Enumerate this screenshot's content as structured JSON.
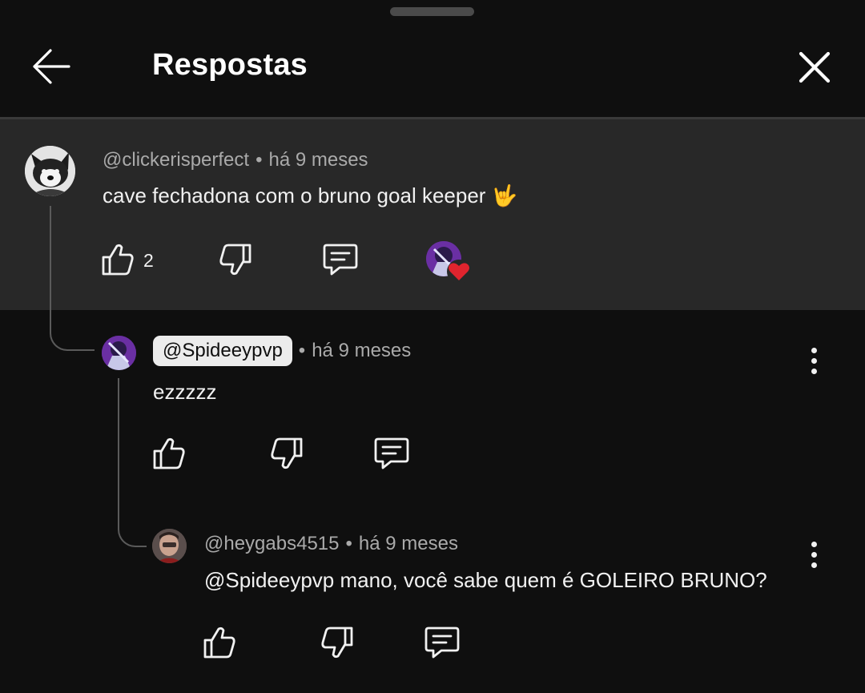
{
  "header": {
    "title": "Respostas"
  },
  "parent": {
    "author": "@clickerisperfect",
    "time": "há 9 meses",
    "text": "cave fechadona com o bruno goal keeper 🤟",
    "like_count": "2"
  },
  "reply1": {
    "author": "@Spideeypvp",
    "time": "há 9 meses",
    "text": "ezzzzz"
  },
  "reply2": {
    "author": "@heygabs4515",
    "time": "há 9 meses",
    "text": "@Spideeypvp mano, você sabe quem é GOLEIRO BRUNO?"
  },
  "meta_separator": "•",
  "icons": {
    "back": "arrow-left-icon",
    "close": "close-icon",
    "like": "thumbs-up-icon",
    "dislike": "thumbs-down-icon",
    "reply": "comment-icon",
    "more": "more-vertical-icon",
    "heart": "heart-icon"
  },
  "colors": {
    "background": "#0f0f0f",
    "highlight": "#282828",
    "heart": "#e0242e",
    "meta_text": "#aaaaaa"
  }
}
